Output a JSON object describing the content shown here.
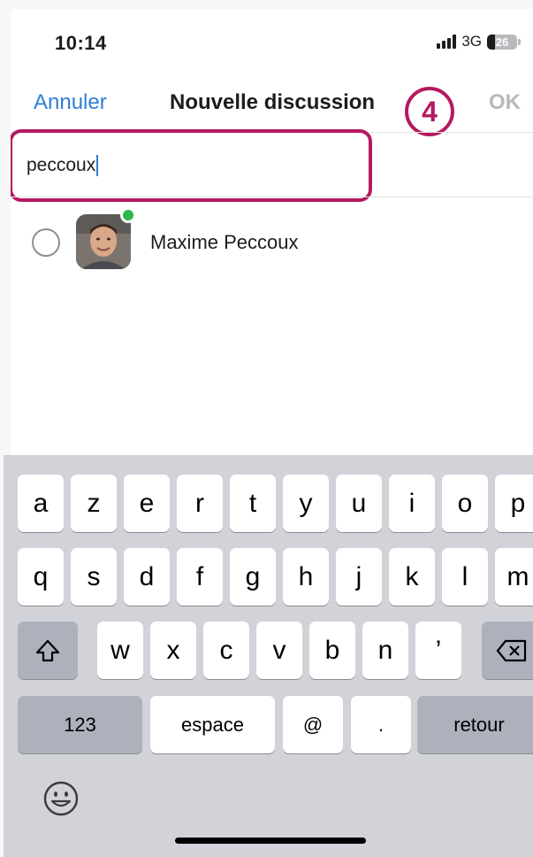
{
  "status_bar": {
    "time": "10:14",
    "network": "3G",
    "battery": "26",
    "battery_level_percent": 26
  },
  "nav": {
    "cancel_label": "Annuler",
    "title": "Nouvelle discussion",
    "ok_label": "OK"
  },
  "step_badge": "4",
  "search": {
    "value": "peccoux"
  },
  "contacts": [
    {
      "name": "Maxime Peccoux",
      "online": true,
      "selected": false
    }
  ],
  "keyboard": {
    "row1": [
      "a",
      "z",
      "e",
      "r",
      "t",
      "y",
      "u",
      "i",
      "o",
      "p"
    ],
    "row2": [
      "q",
      "s",
      "d",
      "f",
      "g",
      "h",
      "j",
      "k",
      "l",
      "m"
    ],
    "row3": [
      "w",
      "x",
      "c",
      "v",
      "b",
      "n",
      "’"
    ],
    "numbers_label": "123",
    "space_label": "espace",
    "at_label": "@",
    "dot_label": ".",
    "return_label": "retour"
  },
  "colors": {
    "accent_blue": "#2f7fd6",
    "highlight_magenta": "#b5195f",
    "online_green": "#2db84d"
  }
}
